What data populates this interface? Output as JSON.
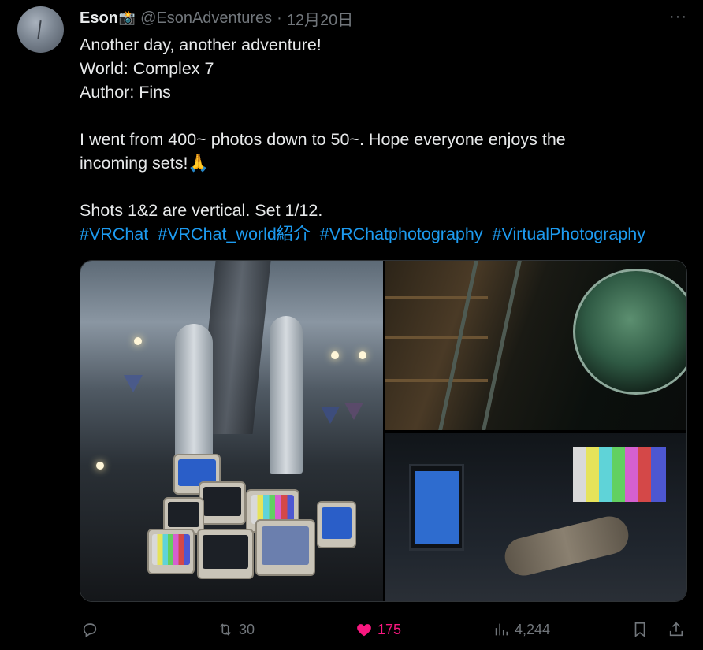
{
  "tweet": {
    "author_name": "Eson",
    "name_emoji": "📸",
    "handle": "@EsonAdventures",
    "separator": "·",
    "date": "12月20日",
    "more_label": "···",
    "lines": [
      "Another day, another adventure!",
      "World: Complex 7",
      "Author: Fins",
      "",
      "I went from 400~ photos down to 50~. Hope everyone enjoys the",
      "incoming sets!🙏",
      "",
      "Shots 1&2 are vertical. Set 1/12."
    ],
    "hashtags": [
      "#VRChat",
      "#VRChat_world紹介",
      "#VRChatphotography",
      "#VirtualPhotography"
    ]
  },
  "media": {
    "images": [
      {
        "name": "vertical photo of stacked retro TVs under a tree with rockets"
      },
      {
        "name": "dark library with ladder and green globe"
      },
      {
        "name": "retro monitor and color-bar TV on floor with rolled rug"
      }
    ]
  },
  "actions": {
    "reply_icon": "reply-icon",
    "retweet_icon": "retweet-icon",
    "retweet_count": "30",
    "like_icon": "heart-icon",
    "like_count": "175",
    "like_color": "#f91880",
    "views_icon": "views-icon",
    "views_count": "4,244",
    "bookmark_icon": "bookmark-icon",
    "share_icon": "share-icon"
  },
  "colors": {
    "background": "#000000",
    "text": "#e7e9ea",
    "muted": "#71767b",
    "link": "#1d9bf0"
  }
}
